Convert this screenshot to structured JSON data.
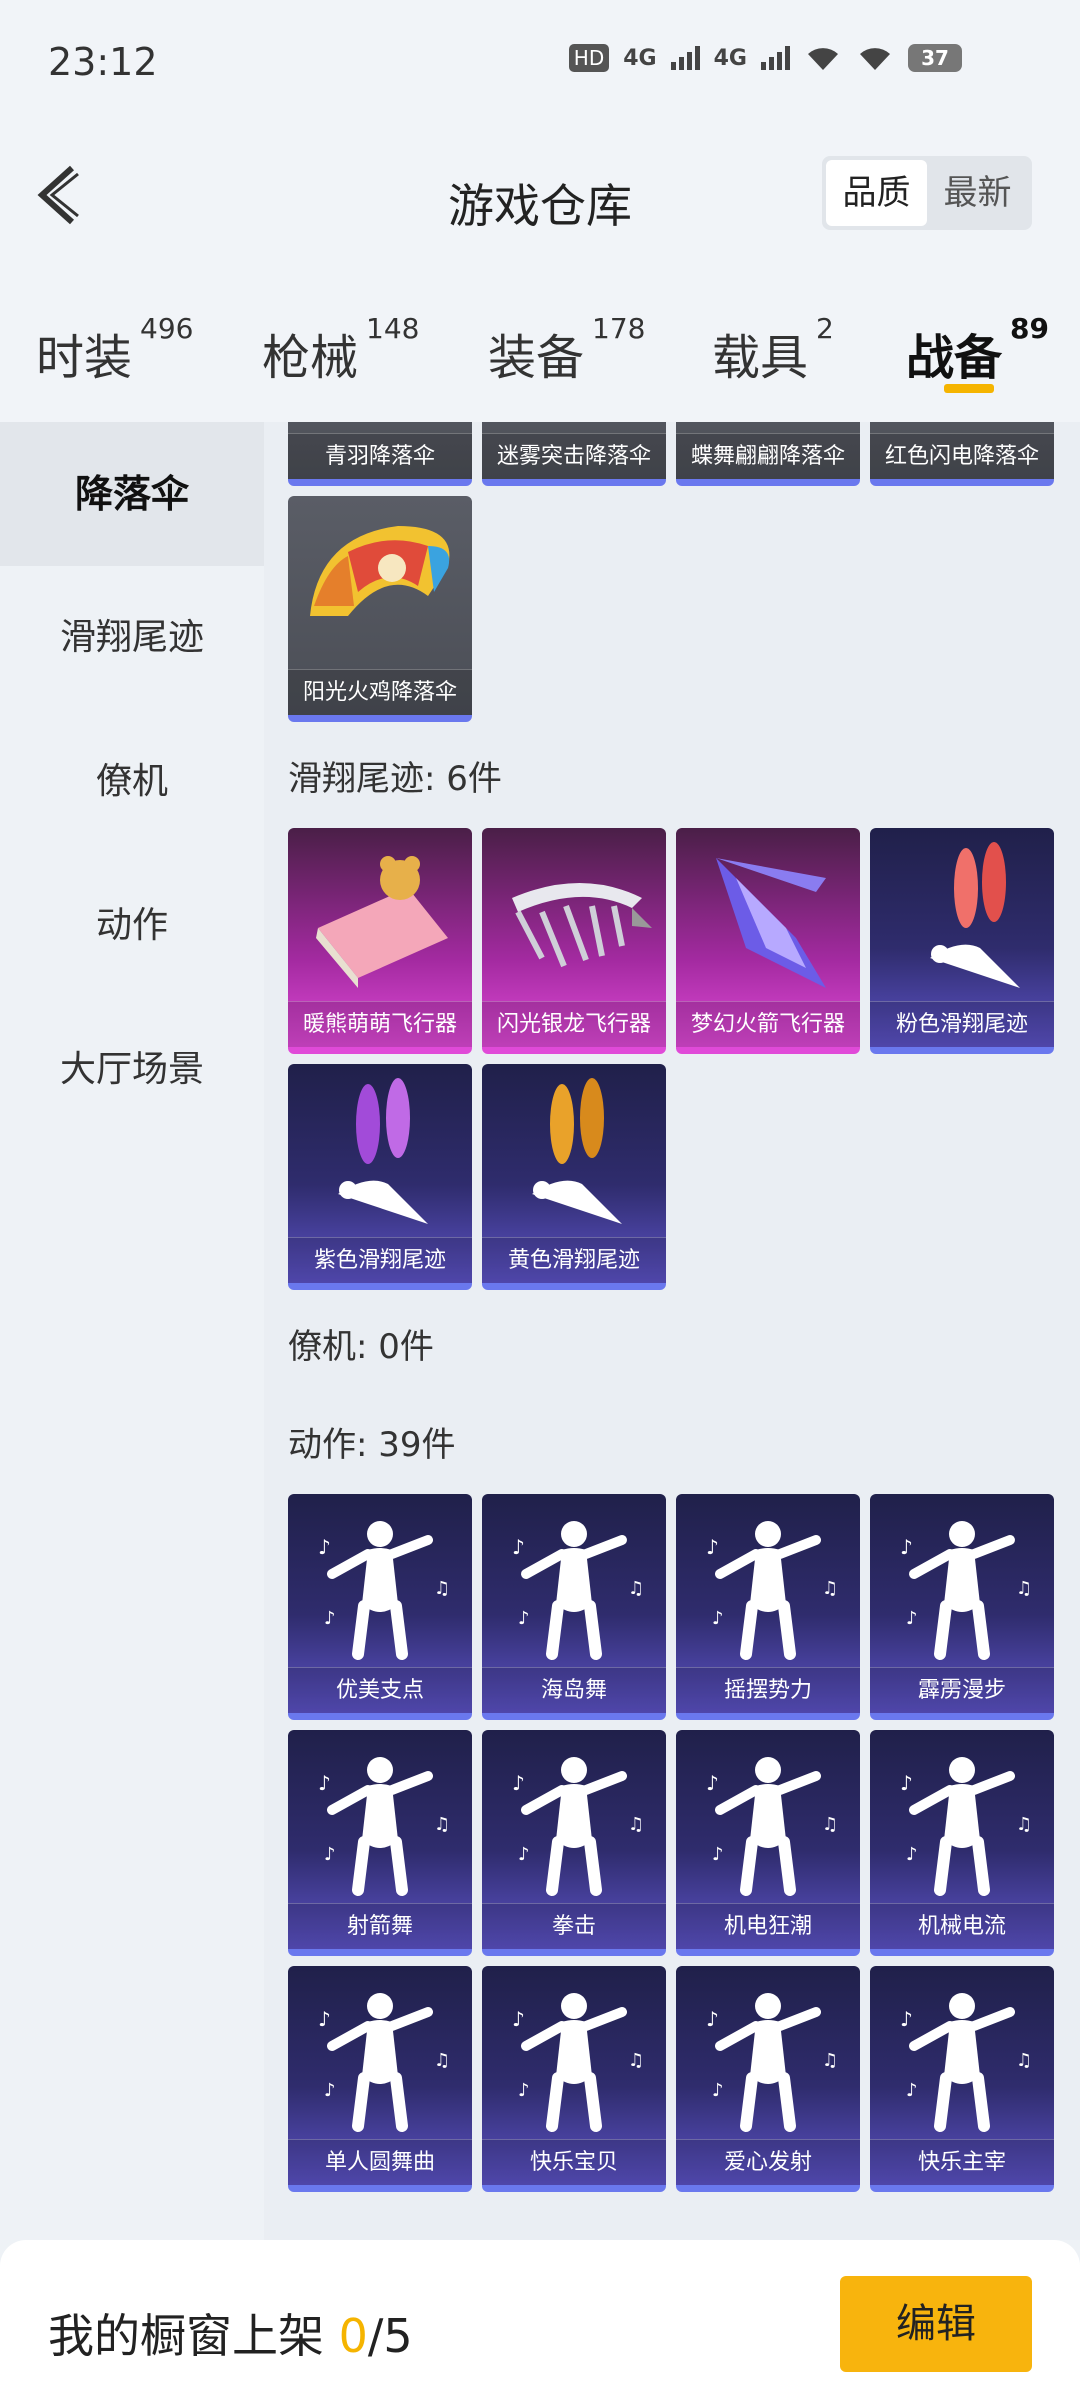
{
  "status": {
    "time": "23:12",
    "battery": "37",
    "hd": "HD",
    "net1": "4G",
    "net2": "4G"
  },
  "header": {
    "title": "游戏仓库",
    "sort": [
      "品质",
      "最新"
    ]
  },
  "tabs": [
    {
      "label": "时装",
      "count": "496"
    },
    {
      "label": "枪械",
      "count": "148"
    },
    {
      "label": "装备",
      "count": "178"
    },
    {
      "label": "载具",
      "count": "2"
    },
    {
      "label": "战备",
      "count": "89"
    }
  ],
  "sidebar": [
    "降落伞",
    "滑翔尾迹",
    "僚机",
    "动作",
    "大厅场景"
  ],
  "sections": {
    "parachute": {
      "items": [
        "青羽降落伞",
        "迷雾突击降落伞",
        "蝶舞翩翩降落伞",
        "红色闪电降落伞",
        "阳光火鸡降落伞"
      ]
    },
    "trail": {
      "title": "滑翔尾迹: 6件",
      "items": [
        "暖熊萌萌飞行器",
        "闪光银龙飞行器",
        "梦幻火箭飞行器",
        "粉色滑翔尾迹",
        "紫色滑翔尾迹",
        "黄色滑翔尾迹"
      ]
    },
    "wingman": {
      "title": "僚机: 0件"
    },
    "emote": {
      "title": "动作: 39件",
      "items": [
        "优美支点",
        "海岛舞",
        "摇摆势力",
        "霹雳漫步",
        "射箭舞",
        "拳击",
        "机电狂潮",
        "机械电流",
        "单人圆舞曲",
        "快乐宝贝",
        "爱心发射",
        "快乐主宰"
      ]
    }
  },
  "bottom": {
    "label": "我的橱窗上架",
    "used": "0",
    "total": "/5",
    "edit": "编辑"
  },
  "colors": {
    "accent": "#f5b400",
    "card_border": "#6a78ee"
  }
}
